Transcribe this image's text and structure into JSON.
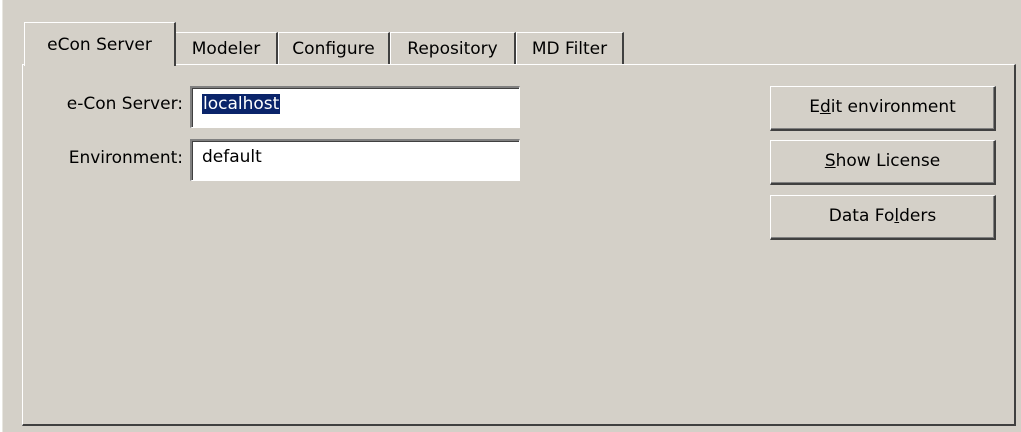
{
  "tabs": [
    {
      "label": "eCon Server",
      "active": true
    },
    {
      "label": "Modeler",
      "active": false
    },
    {
      "label": "Configure",
      "active": false
    },
    {
      "label": "Repository",
      "active": false
    },
    {
      "label": "MD Filter",
      "active": false
    }
  ],
  "form": {
    "server_label": "e-Con Server:",
    "server_value": "localhost",
    "environment_label": "Environment:",
    "environment_value": "default"
  },
  "buttons": {
    "edit_environment": {
      "pre": "E",
      "mnemonic": "d",
      "post": "it environment"
    },
    "show_license": {
      "pre": "",
      "mnemonic": "S",
      "post": "how License"
    },
    "data_folders": {
      "pre": "Data Fo",
      "mnemonic": "l",
      "post": "ders"
    }
  },
  "colors": {
    "face": "#d4d0c8",
    "selection": "#0a246a"
  }
}
